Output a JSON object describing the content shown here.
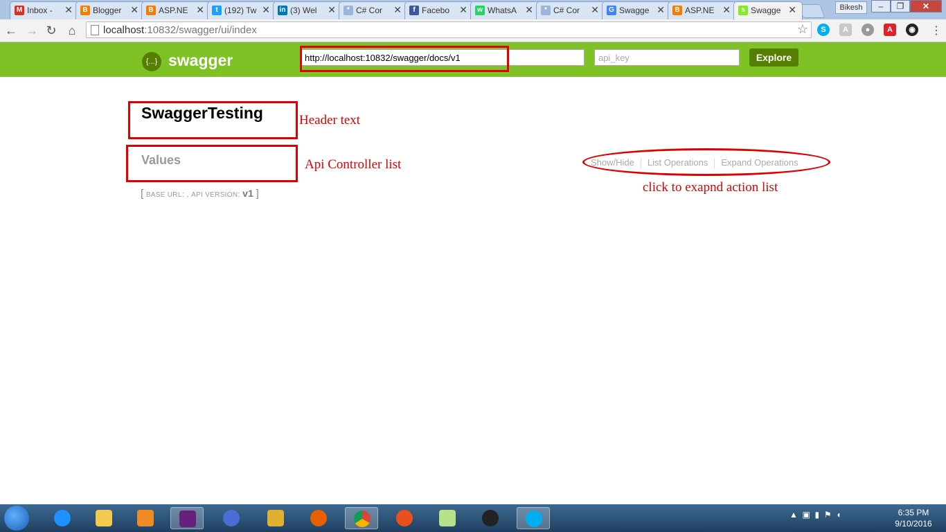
{
  "browser": {
    "tabs": [
      {
        "label": "Inbox -",
        "icon": "gmail-icon",
        "color": "#d93025",
        "glyph": "M"
      },
      {
        "label": "Blogger",
        "icon": "blogger-icon",
        "color": "#f57d00",
        "glyph": "B"
      },
      {
        "label": "ASP.NE",
        "icon": "blogger-icon",
        "color": "#f57d00",
        "glyph": "B"
      },
      {
        "label": "(192) Tw",
        "icon": "twitter-icon",
        "color": "#1da1f2",
        "glyph": "t"
      },
      {
        "label": "(3) Wel",
        "icon": "linkedin-icon",
        "color": "#0077b5",
        "glyph": "in"
      },
      {
        "label": "C# Cor",
        "icon": "csharpcorner-icon",
        "color": "#9bb6dd",
        "glyph": "*"
      },
      {
        "label": "Facebo",
        "icon": "facebook-icon",
        "color": "#3b5998",
        "glyph": "f"
      },
      {
        "label": "WhatsA",
        "icon": "whatsapp-icon",
        "color": "#25d366",
        "glyph": "w"
      },
      {
        "label": "C# Cor",
        "icon": "csharpcorner-icon",
        "color": "#9bb6dd",
        "glyph": "*"
      },
      {
        "label": "Swagge",
        "icon": "google-icon",
        "color": "#4285f4",
        "glyph": "G"
      },
      {
        "label": "ASP.NE",
        "icon": "blogger-icon",
        "color": "#f57d00",
        "glyph": "B"
      },
      {
        "label": "Swagge",
        "icon": "swagger-icon",
        "color": "#85ea2d",
        "glyph": "s"
      }
    ],
    "user": "Bikesh",
    "address": {
      "host": "localhost",
      "rest": ":10832/swagger/ui/index"
    }
  },
  "swagger": {
    "logo_text": "swagger",
    "logo_glyph": "{...}",
    "url_value": "http://localhost:10832/swagger/docs/v1",
    "api_key_placeholder": "api_key",
    "explore_label": "Explore",
    "api_title": "SwaggerTesting",
    "resource": "Values",
    "ops": {
      "show_hide": "Show/Hide",
      "list": "List Operations",
      "expand": "Expand Operations"
    },
    "base": {
      "open": "[",
      "base_url_label": "base url",
      "colon": ":",
      "comma": ",",
      "api_version_label": "api version",
      "version": "v1",
      "close": "]"
    }
  },
  "annotations": {
    "header_text": "Header text",
    "controller_list": "Api Controller list",
    "expand_hint": "click to exapnd action list",
    "color": "#e00000"
  },
  "taskbar": {
    "time": "6:35 PM",
    "date": "9/10/2016"
  }
}
